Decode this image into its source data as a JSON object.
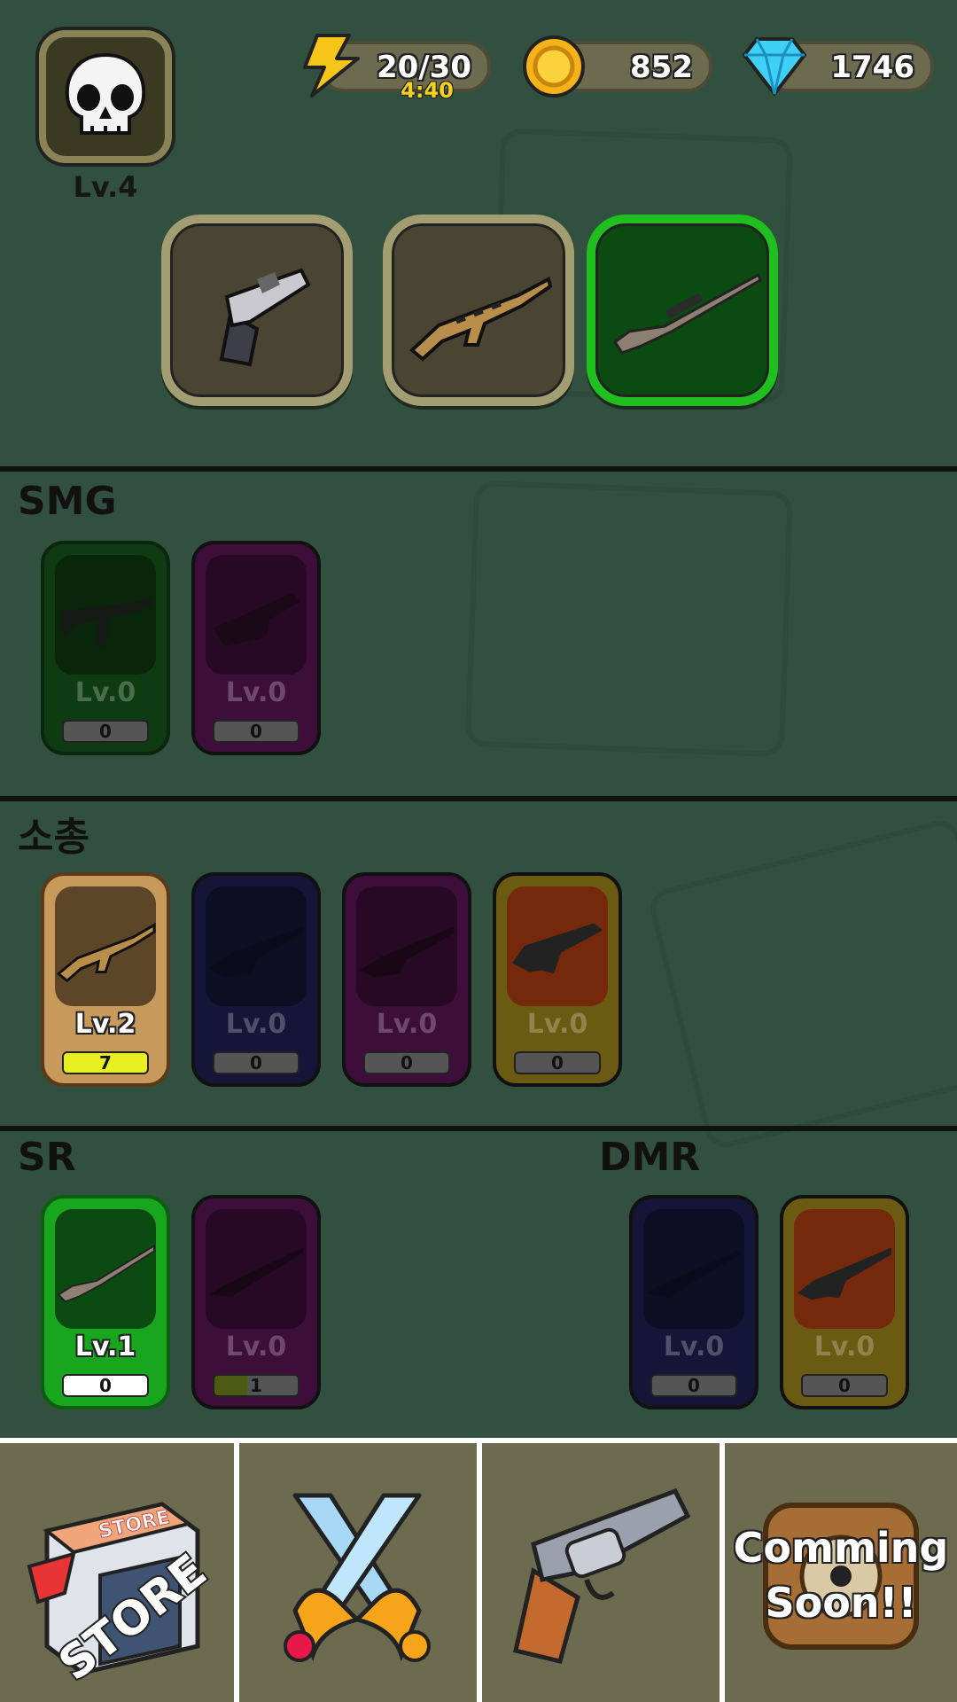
{
  "header": {
    "player_level": "Lv.4",
    "energy": "20/30",
    "energy_timer": "4:40",
    "gold": "852",
    "gems": "1746"
  },
  "equipped": [
    "revolver",
    "zebra-ak",
    "sniper-rifle"
  ],
  "sections": {
    "smg": {
      "title": "SMG",
      "cards": [
        {
          "level": "Lv.0",
          "count": "0"
        },
        {
          "level": "Lv.0",
          "count": "0"
        }
      ]
    },
    "rifle": {
      "title": "소총",
      "cards": [
        {
          "level": "Lv.2",
          "count": "7"
        },
        {
          "level": "Lv.0",
          "count": "0"
        },
        {
          "level": "Lv.0",
          "count": "0"
        },
        {
          "level": "Lv.0",
          "count": "0"
        }
      ]
    },
    "sr": {
      "title": "SR",
      "cards": [
        {
          "level": "Lv.1",
          "count": "0"
        },
        {
          "level": "Lv.0",
          "count": "1"
        }
      ]
    },
    "dmr": {
      "title": "DMR",
      "cards": [
        {
          "level": "Lv.0",
          "count": "0"
        },
        {
          "level": "Lv.0",
          "count": "0"
        }
      ]
    }
  },
  "nav": {
    "store_sign": "STORE",
    "store_box": "STORE",
    "coming_soon": "Comming\nSoon!!"
  },
  "colors": {
    "background": "#31503f",
    "active_slot": "#1fbf1f",
    "energy_timer": "#f3d21a"
  }
}
